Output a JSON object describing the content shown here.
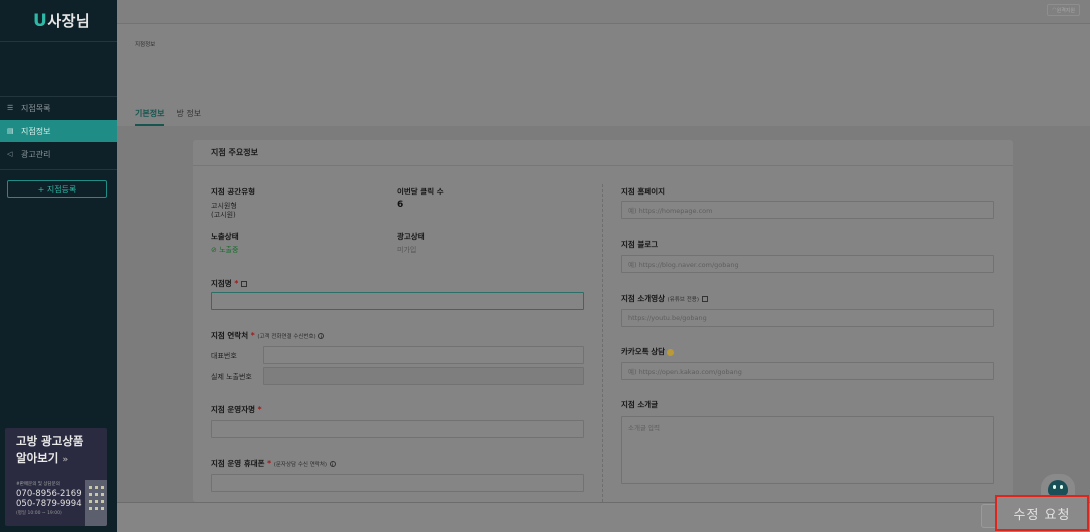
{
  "sidebar": {
    "logo_mark": "U",
    "logo_text": "사장님",
    "items": [
      {
        "label": "지점목록",
        "icon": "list-icon"
      },
      {
        "label": "지점정보",
        "icon": "info-icon",
        "active": true
      },
      {
        "label": "광고관리",
        "icon": "megaphone-icon"
      }
    ],
    "add_button": "+ 지점등록",
    "promo": {
      "title_line1": "고방 광고상품",
      "title_line2": "알아보기",
      "arrow": "»",
      "subtitle": "#판매문의 및 상담문의",
      "phone1": "070-8956-2169",
      "phone2": "050-7879-9994",
      "hours": "(평일 10:00 ~ 19:00)"
    }
  },
  "topbar": {
    "help_label": "원격지원"
  },
  "header": {
    "breadcrumb": "지점정보",
    "tabs": [
      {
        "label": "기본정보",
        "active": true
      },
      {
        "label": "방 정보",
        "active": false
      }
    ]
  },
  "card": {
    "title": "지점 주요정보",
    "space_type_label": "지점 공간유형",
    "space_type_value1": "고시원형",
    "space_type_value2": "(고시원)",
    "monthly_clicks_label": "이번달 클릭 수",
    "monthly_clicks_value": "6",
    "exposure_label": "노출상태",
    "exposure_value": "노출중",
    "ad_status_label": "광고상태",
    "ad_status_value": "미가입",
    "branch_name_label": "지점명",
    "required_mark": "*",
    "contact_label": "지점 연락처",
    "contact_hint": "(고객 전화연결 수신번호)",
    "main_number_label": "대표번호",
    "display_number_label": "실제 노출번호",
    "manager_label": "지점 운영자명",
    "manager_phone_label": "지점 운영 휴대폰",
    "manager_phone_hint": "(문자상담 수신 연락처)",
    "homepage_label": "지점 홈페이지",
    "homepage_placeholder": "예) https://homepage.com",
    "blog_label": "지점 블로그",
    "blog_placeholder": "예) https://blog.naver.com/gobang",
    "video_label": "지점 소개영상",
    "video_hint": "(유튜브 전용)",
    "video_placeholder": "https://youtu.be/gobang",
    "kakao_label": "카카오톡 상담",
    "kakao_placeholder": "예) https://open.kakao.com/gobang",
    "intro_label": "지점 소개글",
    "intro_placeholder": "소개글 입력"
  },
  "footer": {
    "submit_label": "수정 요청"
  },
  "colors": {
    "accent": "#1f8c85",
    "sidebar_bg": "#0f2128",
    "highlight_border": "#e0241c"
  }
}
